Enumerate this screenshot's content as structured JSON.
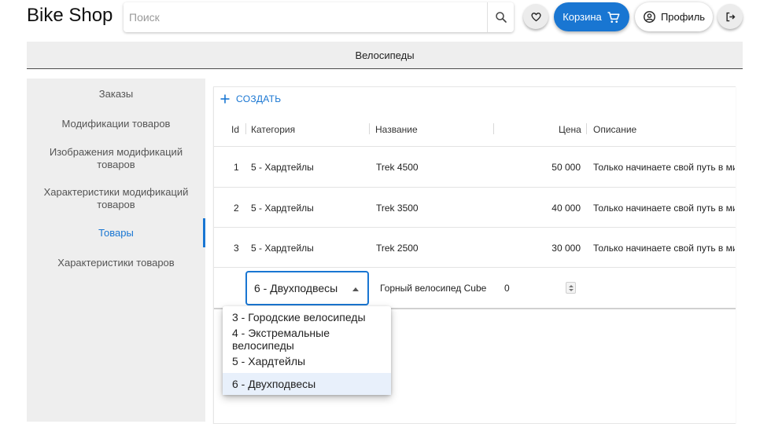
{
  "header": {
    "brand": "Bike Shop",
    "search_placeholder": "Поиск",
    "search_value": "",
    "cart_label": "Корзина",
    "profile_label": "Профиль",
    "icons": [
      "search-icon",
      "heart-icon",
      "cart-icon",
      "account-icon",
      "logout-icon"
    ]
  },
  "page": {
    "title": "Велосипеды"
  },
  "sidebar": {
    "items": [
      {
        "label": "Заказы",
        "active": false
      },
      {
        "label": "Модификации товаров",
        "active": false
      },
      {
        "label": "Изображения модификаций товаров",
        "active": false
      },
      {
        "label": "Характеристики модификаций товаров",
        "active": false
      },
      {
        "label": "Товары",
        "active": true
      },
      {
        "label": "Характеристики товаров",
        "active": false
      }
    ]
  },
  "grid": {
    "create_label": "СОЗДАТЬ",
    "columns": [
      "Id",
      "Категория",
      "Название",
      "Цена",
      "Описание"
    ],
    "rows": [
      {
        "id": "1",
        "category": "5 - Хардтейлы",
        "name": "Trek 4500",
        "price": "50 000",
        "description": "Только начинаете свой путь в мир"
      },
      {
        "id": "2",
        "category": "5 - Хардтейлы",
        "name": "Trek 3500",
        "price": "40 000",
        "description": "Только начинаете свой путь в мир"
      },
      {
        "id": "3",
        "category": "5 - Хардтейлы",
        "name": "Trek 2500",
        "price": "30 000",
        "description": "Только начинаете свой путь в мир"
      }
    ],
    "edit_row": {
      "category_value": "6 - Двухподвесы",
      "name_value": "Горный велосипед Cube",
      "price_value": "0"
    },
    "category_options": [
      {
        "label": "3 - Городские велосипеды",
        "selected": false
      },
      {
        "label": "4 - Экстремальные велосипеды",
        "selected": false
      },
      {
        "label": "5 - Хардтейлы",
        "selected": false
      },
      {
        "label": "6 - Двухподвесы",
        "selected": true
      }
    ]
  },
  "colors": {
    "accent": "#1976d2",
    "sidebar_bg": "#eeeeee",
    "selected_option_bg": "#e8f0fb"
  }
}
